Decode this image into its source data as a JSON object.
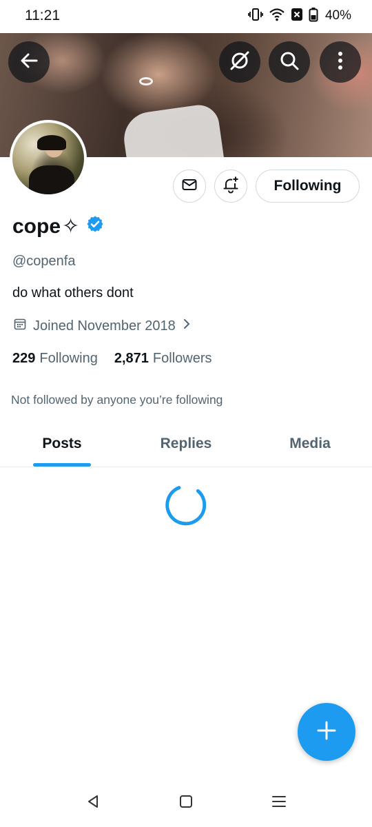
{
  "status_bar": {
    "time": "11:21",
    "battery": "40%",
    "icons": [
      "vibrate-icon",
      "wifi-icon",
      "no-sim-icon",
      "battery-icon"
    ]
  },
  "header": {
    "icons": [
      "back-arrow-icon",
      "grok-icon",
      "search-icon",
      "more-vertical-icon"
    ]
  },
  "profile": {
    "display_name": "cope",
    "name_emoji": "✧",
    "verified": true,
    "handle": "@copenfa",
    "bio": "do what others dont",
    "joined": "Joined November 2018",
    "following_count": "229",
    "following_label": "Following",
    "followers_count": "2,871",
    "followers_label": "Followers",
    "followed_by": "Not followed by anyone you’re following"
  },
  "actions": {
    "following_button": "Following",
    "icons": [
      "message-icon",
      "notification-bell-plus-icon"
    ]
  },
  "tabs": [
    {
      "label": "Posts",
      "active": true
    },
    {
      "label": "Replies",
      "active": false
    },
    {
      "label": "Media",
      "active": false
    }
  ],
  "colors": {
    "accent": "#1d9bf0",
    "text_primary": "#0f1419",
    "text_secondary": "#536471",
    "border": "#cfd9de"
  },
  "fab": {
    "icon": "plus-icon"
  },
  "nav_bar": {
    "icons": [
      "nav-back-icon",
      "nav-home-icon",
      "nav-recents-icon"
    ]
  }
}
